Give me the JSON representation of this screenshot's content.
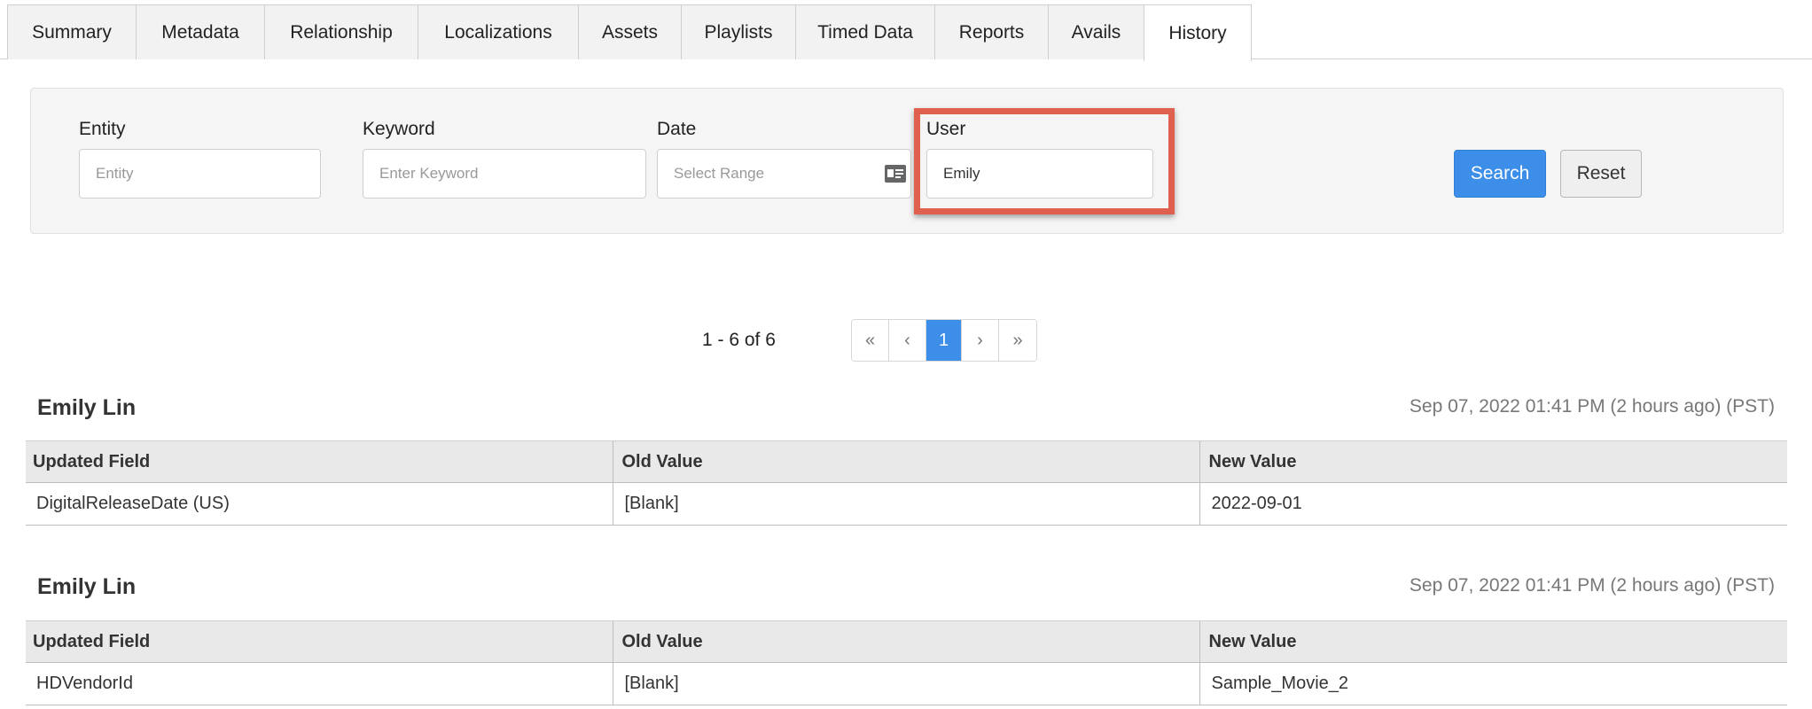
{
  "tabs": [
    "Summary",
    "Metadata",
    "Relationship",
    "Localizations",
    "Assets",
    "Playlists",
    "Timed Data",
    "Reports",
    "Avails",
    "History"
  ],
  "active_tab": "History",
  "filters": {
    "entity": {
      "label": "Entity",
      "placeholder": "Entity",
      "value": ""
    },
    "keyword": {
      "label": "Keyword",
      "placeholder": "Enter Keyword",
      "value": ""
    },
    "date": {
      "label": "Date",
      "placeholder": "Select Range",
      "value": ""
    },
    "user": {
      "label": "User",
      "placeholder": "",
      "value": "Emily"
    },
    "search_label": "Search",
    "reset_label": "Reset"
  },
  "pagination": {
    "summary": "1 - 6 of 6",
    "first": "«",
    "prev": "‹",
    "current": "1",
    "next": "›",
    "last": "»"
  },
  "columns": [
    "Updated Field",
    "Old Value",
    "New Value"
  ],
  "entries": [
    {
      "user": "Emily Lin",
      "timestamp": "Sep 07, 2022 01:41 PM (2 hours ago) (PST)",
      "rows": [
        [
          "DigitalReleaseDate (US)",
          "[Blank]",
          "2022-09-01"
        ]
      ]
    },
    {
      "user": "Emily Lin",
      "timestamp": "Sep 07, 2022 01:41 PM (2 hours ago) (PST)",
      "rows": [
        [
          "HDVendorId",
          "[Blank]",
          "Sample_Movie_2"
        ]
      ]
    }
  ],
  "colors": {
    "accent": "#3d8ee8",
    "highlight": "#e0604f",
    "panel": "#f5f5f5"
  },
  "icons": {
    "date": "calendar-icon"
  }
}
